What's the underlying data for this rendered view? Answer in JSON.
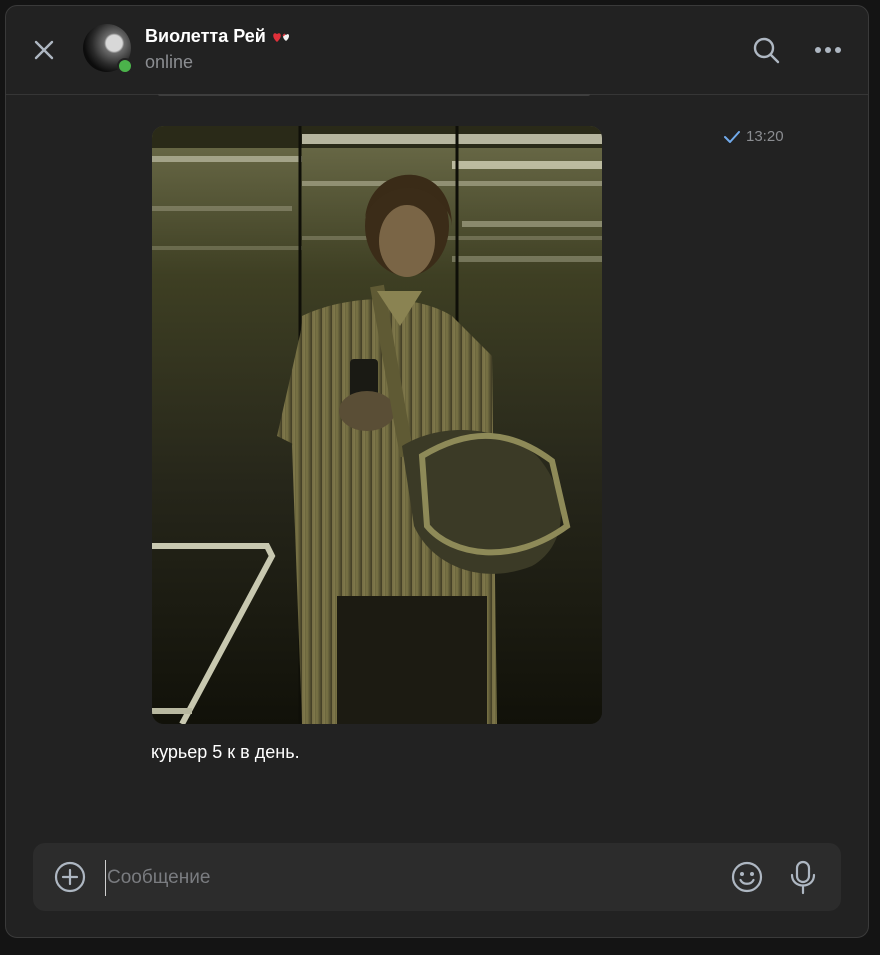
{
  "header": {
    "contact_name": "Виолетта Рей",
    "status": "online",
    "icons": {
      "close": "close-icon",
      "search": "search-icon",
      "more": "more-icon",
      "name_badge": "hearts-emoji-icon"
    }
  },
  "message": {
    "time": "13:20",
    "read_status_icon": "check-icon",
    "photo": "elevator-mirror-selfie-photo",
    "text": "курьер 5 к в день."
  },
  "composer": {
    "placeholder": "Сообщение",
    "value": "",
    "icons": {
      "attach": "plus-circle-icon",
      "emoji": "smile-icon",
      "voice": "microphone-icon"
    }
  },
  "colors": {
    "background": "#222222",
    "composer_bg": "#2c2c2c",
    "accent": "#71aaeb",
    "online": "#4bb34b"
  }
}
